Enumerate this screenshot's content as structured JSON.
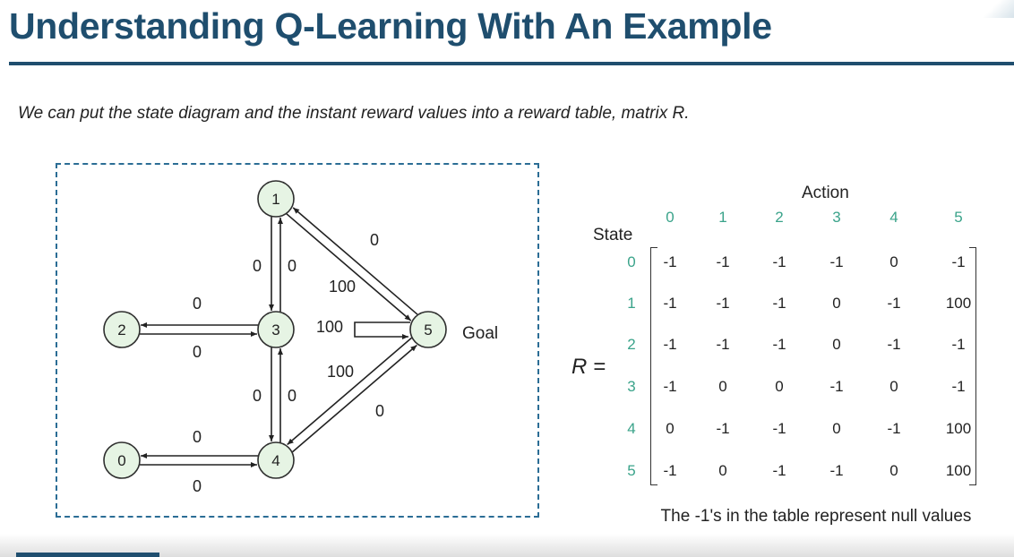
{
  "title": "Understanding Q-Learning With An Example",
  "subtitle": "We can put the state diagram and the instant reward values into a reward table, matrix R.",
  "diagram": {
    "nodes": [
      {
        "id": "1",
        "label": "1"
      },
      {
        "id": "2",
        "label": "2"
      },
      {
        "id": "3",
        "label": "3"
      },
      {
        "id": "5",
        "label": "5"
      },
      {
        "id": "0",
        "label": "0"
      },
      {
        "id": "4",
        "label": "4"
      }
    ],
    "goal_label": "Goal",
    "edges": [
      {
        "from": "2",
        "to": "3",
        "reward": "0"
      },
      {
        "from": "3",
        "to": "2",
        "reward": "0"
      },
      {
        "from": "1",
        "to": "3",
        "reward": "0"
      },
      {
        "from": "3",
        "to": "1",
        "reward": "0"
      },
      {
        "from": "3",
        "to": "4",
        "reward": "0"
      },
      {
        "from": "4",
        "to": "3",
        "reward": "0"
      },
      {
        "from": "0",
        "to": "4",
        "reward": "0"
      },
      {
        "from": "4",
        "to": "0",
        "reward": "0"
      },
      {
        "from": "1",
        "to": "5",
        "reward": "100"
      },
      {
        "from": "5",
        "to": "1",
        "reward": "0"
      },
      {
        "from": "4",
        "to": "5",
        "reward": "100"
      },
      {
        "from": "5",
        "to": "4",
        "reward": "0"
      },
      {
        "from": "5",
        "to": "5",
        "reward": "100"
      }
    ]
  },
  "matrix": {
    "r_label": "R =",
    "action_title": "Action",
    "state_title": "State",
    "actions": [
      "0",
      "1",
      "2",
      "3",
      "4",
      "5"
    ],
    "states": [
      "0",
      "1",
      "2",
      "3",
      "4",
      "5"
    ],
    "rows": [
      [
        "-1",
        "-1",
        "-1",
        "-1",
        "0",
        "-1"
      ],
      [
        "-1",
        "-1",
        "-1",
        "0",
        "-1",
        "100"
      ],
      [
        "-1",
        "-1",
        "-1",
        "0",
        "-1",
        "-1"
      ],
      [
        "-1",
        "0",
        "0",
        "-1",
        "0",
        "-1"
      ],
      [
        "0",
        "-1",
        "-1",
        "0",
        "-1",
        "100"
      ],
      [
        "-1",
        "0",
        "-1",
        "-1",
        "0",
        "100"
      ]
    ],
    "note": "The -1's in the table represent null values"
  },
  "colors": {
    "title": "#1f4e6e",
    "index_green": "#3aa38a",
    "node_fill": "#e6f4e4",
    "dashed_border": "#2b6d95"
  }
}
